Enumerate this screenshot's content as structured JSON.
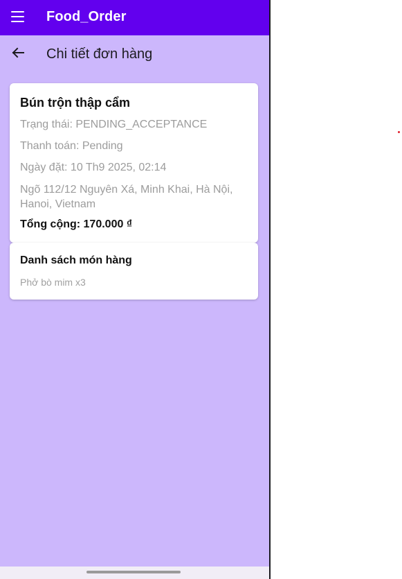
{
  "app_bar": {
    "title": "Food_Order",
    "menu_icon": "menu-icon"
  },
  "subheader": {
    "title": "Chi tiết đơn hàng",
    "back_icon": "arrow-back-icon"
  },
  "order": {
    "name": "Bún trộn thập cẩm",
    "status": "Trạng thái: PENDING_ACCEPTANCE",
    "payment": "Thanh toán: Pending",
    "date": "Ngày đặt: 10 Th9 2025, 02:14",
    "address": "Ngõ 112/12 Nguyên Xá, Minh Khai, Hà Nội, Hanoi, Vietnam",
    "total": "Tổng cộng: 170.000 ₫"
  },
  "items_section": {
    "title": "Danh sách món hàng",
    "items": [
      "Phở bò mim x3"
    ]
  },
  "colors": {
    "app_bar": "#6200ee",
    "background": "#ccb7fc",
    "card": "#ffffff",
    "secondary_text": "#9c9c9c",
    "red_dot": "#e0202e"
  }
}
